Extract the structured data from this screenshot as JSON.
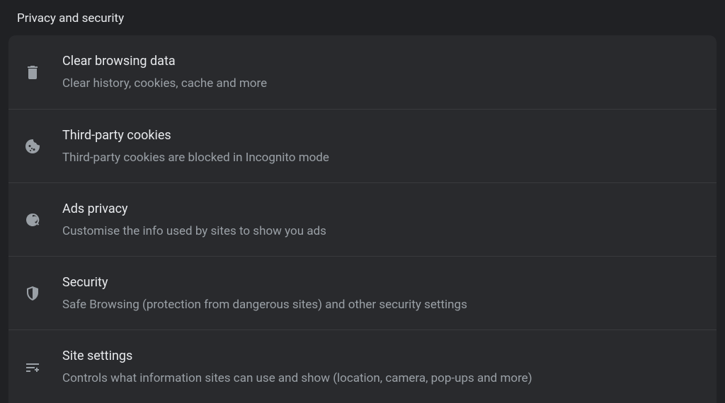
{
  "header": {
    "title": "Privacy and security"
  },
  "items": [
    {
      "icon": "trash-icon",
      "title": "Clear browsing data",
      "subtitle": "Clear history, cookies, cache and more"
    },
    {
      "icon": "cookie-icon",
      "title": "Third-party cookies",
      "subtitle": "Third-party cookies are blocked in Incognito mode"
    },
    {
      "icon": "ads-icon",
      "title": "Ads privacy",
      "subtitle": "Customise the info used by sites to show you ads"
    },
    {
      "icon": "shield-icon",
      "title": "Security",
      "subtitle": "Safe Browsing (protection from dangerous sites) and other security settings"
    },
    {
      "icon": "tune-icon",
      "title": "Site settings",
      "subtitle": "Controls what information sites can use and show (location, camera, pop-ups and more)"
    }
  ]
}
